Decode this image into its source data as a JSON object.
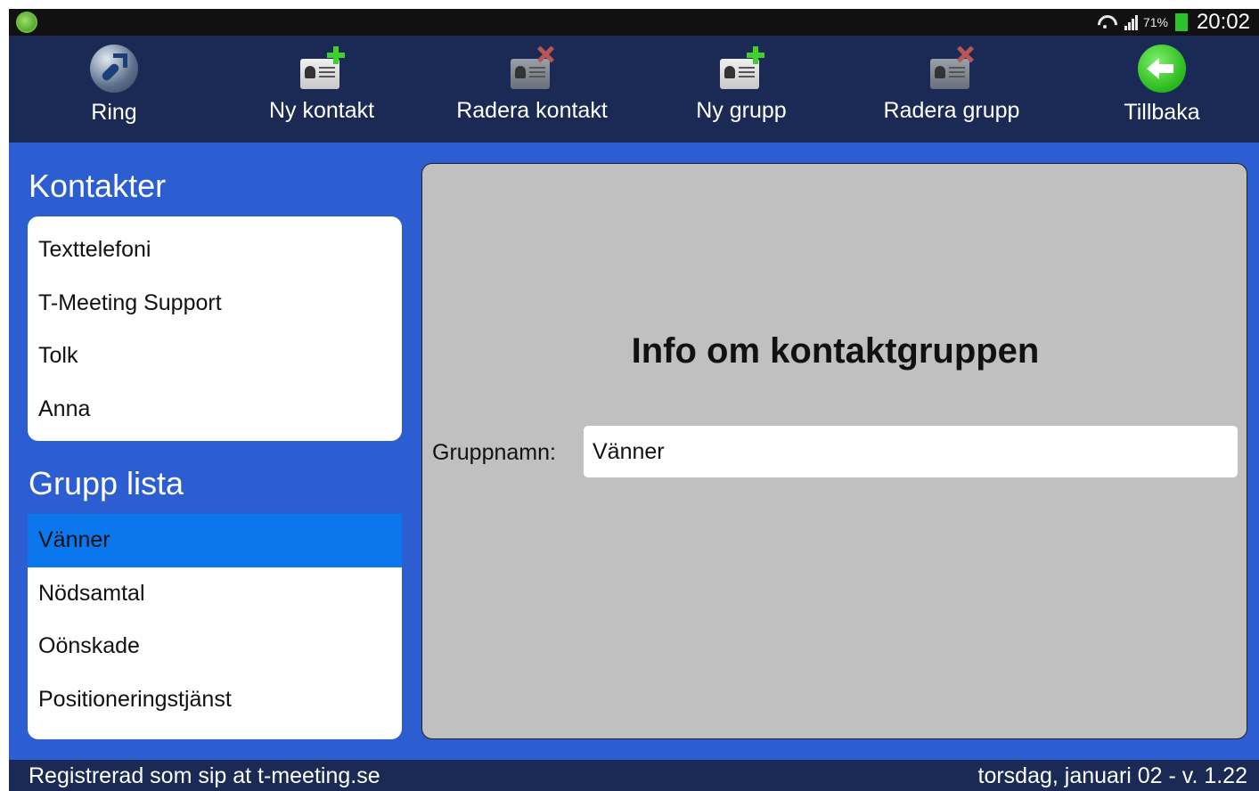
{
  "status_bar": {
    "battery_percent": "71%",
    "time": "20:02"
  },
  "toolbar": {
    "ring_label": "Ring",
    "new_contact_label": "Ny kontakt",
    "delete_contact_label": "Radera kontakt",
    "new_group_label": "Ny grupp",
    "delete_group_label": "Radera grupp",
    "back_label": "Tillbaka"
  },
  "contacts": {
    "title": "Kontakter",
    "items": [
      "Texttelefoni",
      "T-Meeting Support",
      "Tolk",
      "Anna"
    ]
  },
  "groups": {
    "title": "Grupp lista",
    "items": [
      "Vänner",
      "Nödsamtal",
      "Oönskade",
      "Positioneringstjänst"
    ],
    "selected": "Vänner"
  },
  "group_info": {
    "title": "Info om kontaktgruppen",
    "name_label": "Gruppnamn:",
    "name_value": "Vänner"
  },
  "footer": {
    "registration": "Registrerad som sip at t-meeting.se",
    "date_version": "torsdag, januari 02 - v. 1.22"
  },
  "colors": {
    "toolbar_bg": "#1a2a55",
    "main_bg": "#2c5ed1",
    "selected_item": "#0a78ec",
    "panel_bg": "#c0c0c0"
  }
}
